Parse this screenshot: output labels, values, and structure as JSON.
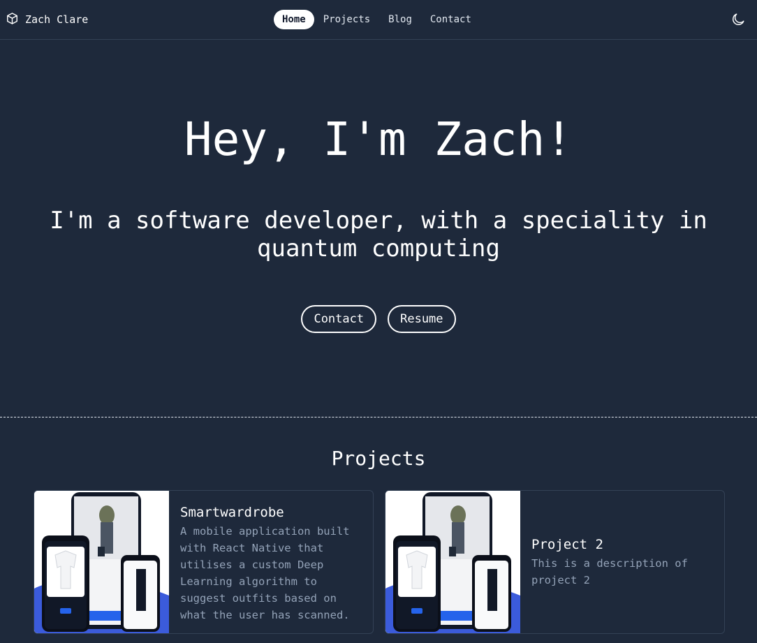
{
  "nav": {
    "brand": "Zach Clare",
    "links": [
      "Home",
      "Projects",
      "Blog",
      "Contact"
    ],
    "active": "Home"
  },
  "hero": {
    "title": "Hey, I'm Zach!",
    "subtitle": "I'm a software developer, with a speciality in quantum computing",
    "buttons": [
      "Contact",
      "Resume"
    ]
  },
  "projects": {
    "heading": "Projects",
    "items": [
      {
        "title": "Smartwardrobe",
        "description": "A mobile application built with React Native that utilises a custom Deep Learning algorithm to suggest outfits based on what the user has scanned."
      },
      {
        "title": "Project 2",
        "description": "This is a description of project 2"
      }
    ]
  },
  "icons": {
    "brand": "cube-icon",
    "theme": "moon-icon"
  },
  "colors": {
    "background": "#1e293b",
    "muted_text": "#94a3b8",
    "accent_blue": "#3b5bdb"
  }
}
